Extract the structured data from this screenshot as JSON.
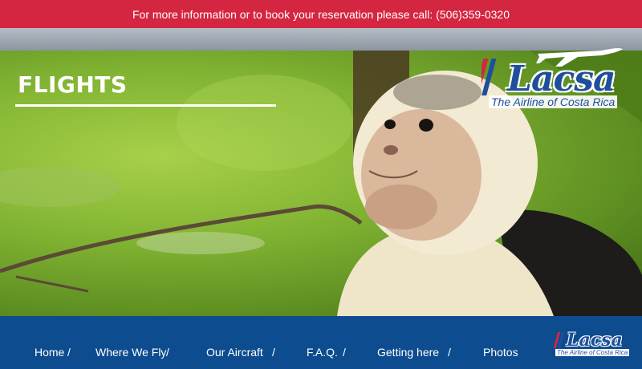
{
  "topbar": {
    "text": "For more information or to book your reservation please call: (506)359-0320"
  },
  "hero": {
    "title": "FLIGHTS"
  },
  "logo": {
    "word": "Lacsa",
    "tagline": "The Airline of Costa Rica"
  },
  "nav": {
    "items": [
      {
        "label": "Home"
      },
      {
        "label": "Where We Fly"
      },
      {
        "label": "Our Aircraft"
      },
      {
        "label": "F.A.Q."
      },
      {
        "label": "Getting here"
      },
      {
        "label": "Photos"
      }
    ],
    "separator": "/"
  },
  "footer_logo": {
    "word": "Lacsa",
    "tagline": "The Airline of Costa Rica"
  },
  "colors": {
    "topbar": "#d42641",
    "footer": "#0d4c8f",
    "brand_blue": "#1f4f9c",
    "brand_red": "#d42641"
  }
}
